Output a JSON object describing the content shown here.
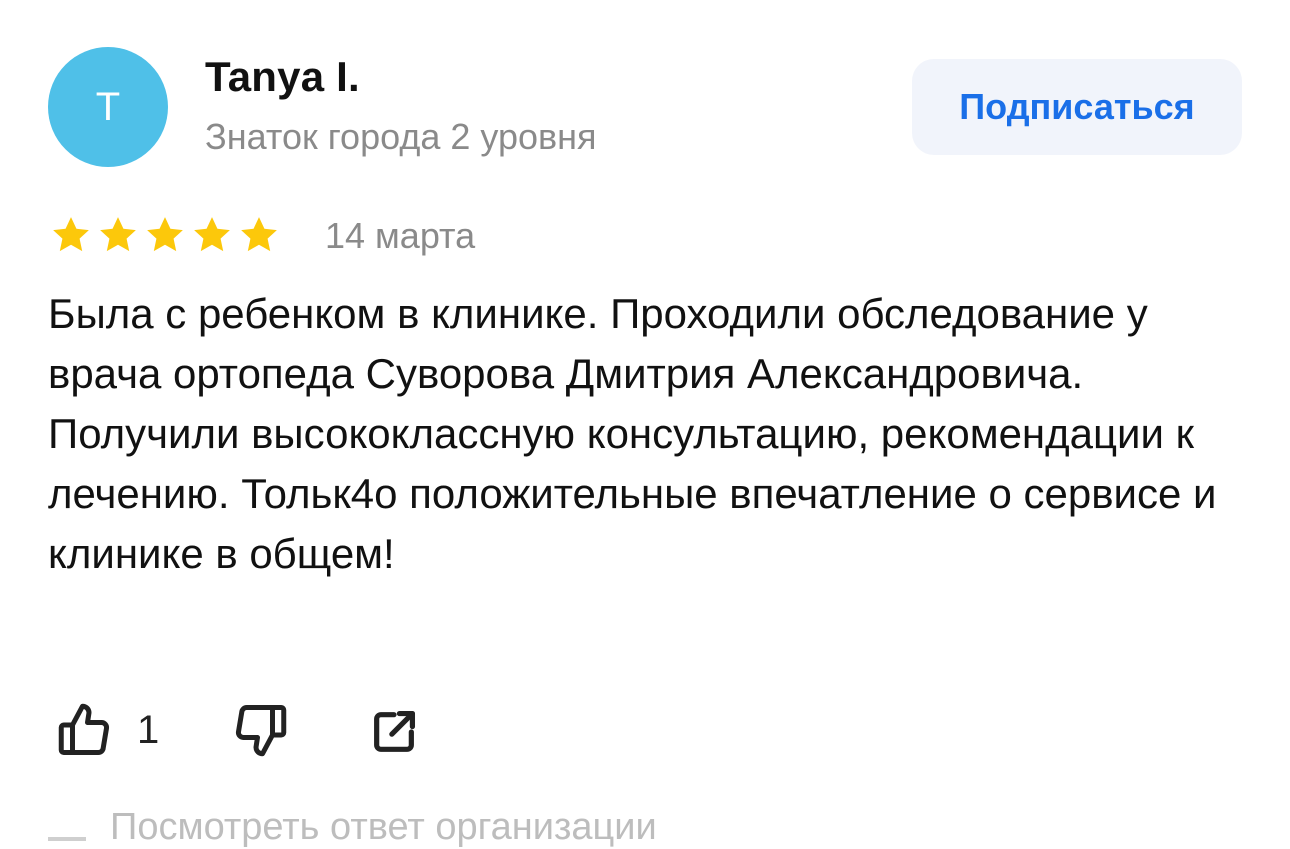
{
  "author": {
    "initial": "T",
    "name": "Tanya I.",
    "level": "Знаток города 2 уровня",
    "avatar_color": "#4fc0e8"
  },
  "subscribe_label": "Подписаться",
  "review": {
    "rating": 5,
    "rating_max": 5,
    "star_color": "#fcc80b",
    "date": "14 марта",
    "text": "Была с ребенком в клинике. Проходили обследование у врача ортопеда Суворова Дмитрия Александровича. Получили высококлассную консультацию, рекомендации к лечению. Тольк4о положительные впечатление о сервисе и клинике в общем!"
  },
  "actions": {
    "like_icon": "thumbs-up-icon",
    "like_count": "1",
    "dislike_icon": "thumbs-down-icon",
    "share_icon": "share-icon"
  },
  "org_reply_label": "Посмотреть ответ организации",
  "colors": {
    "accent": "#1a6fe8",
    "button_bg": "#f1f4fb",
    "muted_text": "#8a8a8a"
  }
}
